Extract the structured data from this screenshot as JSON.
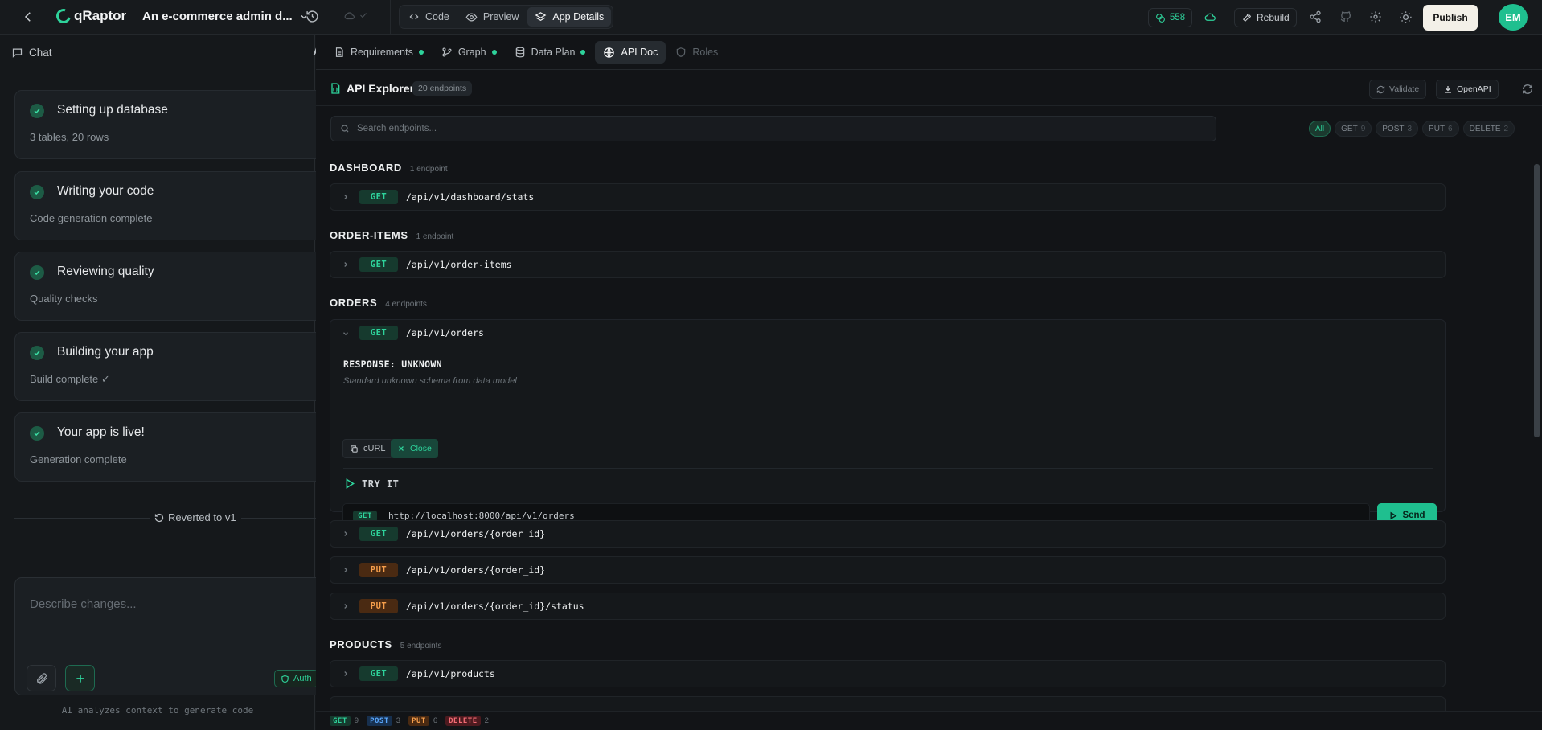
{
  "topbar": {
    "brand": "qRaptor",
    "project_title": "An e-commerce admin d...",
    "modes": [
      {
        "label": "Code",
        "icon": "code-icon"
      },
      {
        "label": "Preview",
        "icon": "eye-icon"
      },
      {
        "label": "App Details",
        "icon": "layers-icon",
        "active": true
      }
    ],
    "credits": "558",
    "rebuild_label": "Rebuild",
    "publish_label": "Publish",
    "avatar_initials": "EM"
  },
  "chat": {
    "header_label": "Chat",
    "font_button": "A",
    "steps": [
      {
        "title": "Setting up database",
        "subtitle": "3 tables, 20 rows"
      },
      {
        "title": "Writing your code",
        "subtitle": "Code generation complete"
      },
      {
        "title": "Reviewing quality",
        "subtitle": "Quality checks"
      },
      {
        "title": "Building your app",
        "subtitle": "Build complete ✓"
      },
      {
        "title": "Your app is live!",
        "subtitle": "Generation complete"
      }
    ],
    "reverted_label": "Reverted to v1",
    "composer_placeholder": "Describe changes...",
    "auth_label": "Auth",
    "footnote": "AI analyzes context to generate code"
  },
  "tabs": [
    {
      "label": "Requirements",
      "dot": true
    },
    {
      "label": "Graph",
      "dot": true
    },
    {
      "label": "Data Plan",
      "dot": true
    },
    {
      "label": "API Doc",
      "active": true
    },
    {
      "label": "Roles",
      "disabled": true
    }
  ],
  "explorer": {
    "title": "API Explorer",
    "count": "20 endpoints",
    "validate_label": "Validate",
    "openapi_label": "OpenAPI",
    "search_placeholder": "Search endpoints...",
    "filters": [
      {
        "label": "All",
        "count": "",
        "active": true
      },
      {
        "label": "GET",
        "count": "9"
      },
      {
        "label": "POST",
        "count": "3"
      },
      {
        "label": "PUT",
        "count": "6"
      },
      {
        "label": "DELETE",
        "count": "2"
      }
    ]
  },
  "groups": {
    "dashboard": {
      "name": "DASHBOARD",
      "count": "1 endpoint"
    },
    "order_items": {
      "name": "ORDER-ITEMS",
      "count": "1 endpoint"
    },
    "orders": {
      "name": "ORDERS",
      "count": "4 endpoints"
    },
    "products": {
      "name": "PRODUCTS",
      "count": "5 endpoints"
    }
  },
  "endpoints": {
    "dashboard_stats": {
      "method": "GET",
      "path": "/api/v1/dashboard/stats"
    },
    "order_items": {
      "method": "GET",
      "path": "/api/v1/order-items"
    },
    "orders_list": {
      "method": "GET",
      "path": "/api/v1/orders"
    },
    "orders_get": {
      "method": "GET",
      "path": "/api/v1/orders/{order_id}"
    },
    "orders_put": {
      "method": "PUT",
      "path": "/api/v1/orders/{order_id}"
    },
    "orders_status": {
      "method": "PUT",
      "path": "/api/v1/orders/{order_id}/status"
    },
    "products_list": {
      "method": "GET",
      "path": "/api/v1/products"
    }
  },
  "expanded": {
    "response_title": "RESPONSE: UNKNOWN",
    "response_desc": "Standard unknown schema from data model",
    "curl_label": "cURL",
    "close_label": "Close",
    "try_it_label": "TRY IT",
    "try_method": "GET",
    "try_url": "http://localhost:8000/api/v1/orders",
    "send_label": "Send"
  },
  "footer": [
    {
      "method": "GET",
      "count": "9"
    },
    {
      "method": "POST",
      "count": "3"
    },
    {
      "method": "PUT",
      "count": "6"
    },
    {
      "method": "DELETE",
      "count": "2"
    }
  ]
}
